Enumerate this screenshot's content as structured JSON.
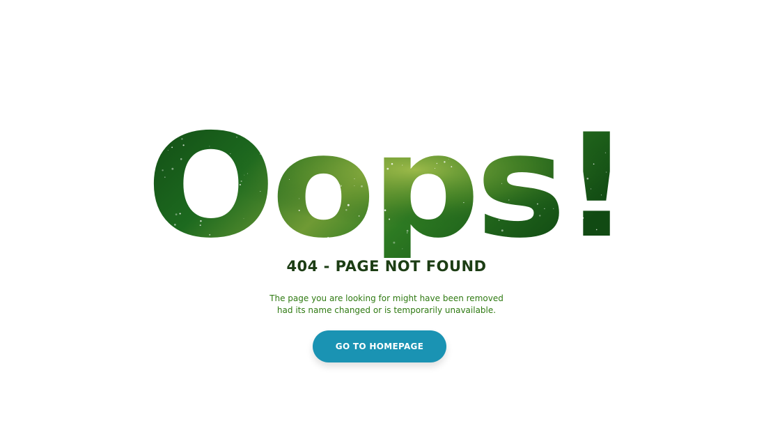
{
  "hero": {
    "title": "Oops!"
  },
  "error": {
    "heading": "404 - PAGE NOT FOUND",
    "message_line1": "The page you are looking for might have been removed",
    "message_line2": "had its name changed or is temporarily unavailable."
  },
  "actions": {
    "home_button_label": "GO TO HOMEPAGE"
  },
  "colors": {
    "background": "#ffffff",
    "heading": "#1c3d14",
    "message": "#2f7a12",
    "button": "#1a93b3",
    "galaxy_dark": "#0f4a12",
    "galaxy_light": "#8fb03a"
  },
  "icons": [
    "galaxy-texture"
  ]
}
